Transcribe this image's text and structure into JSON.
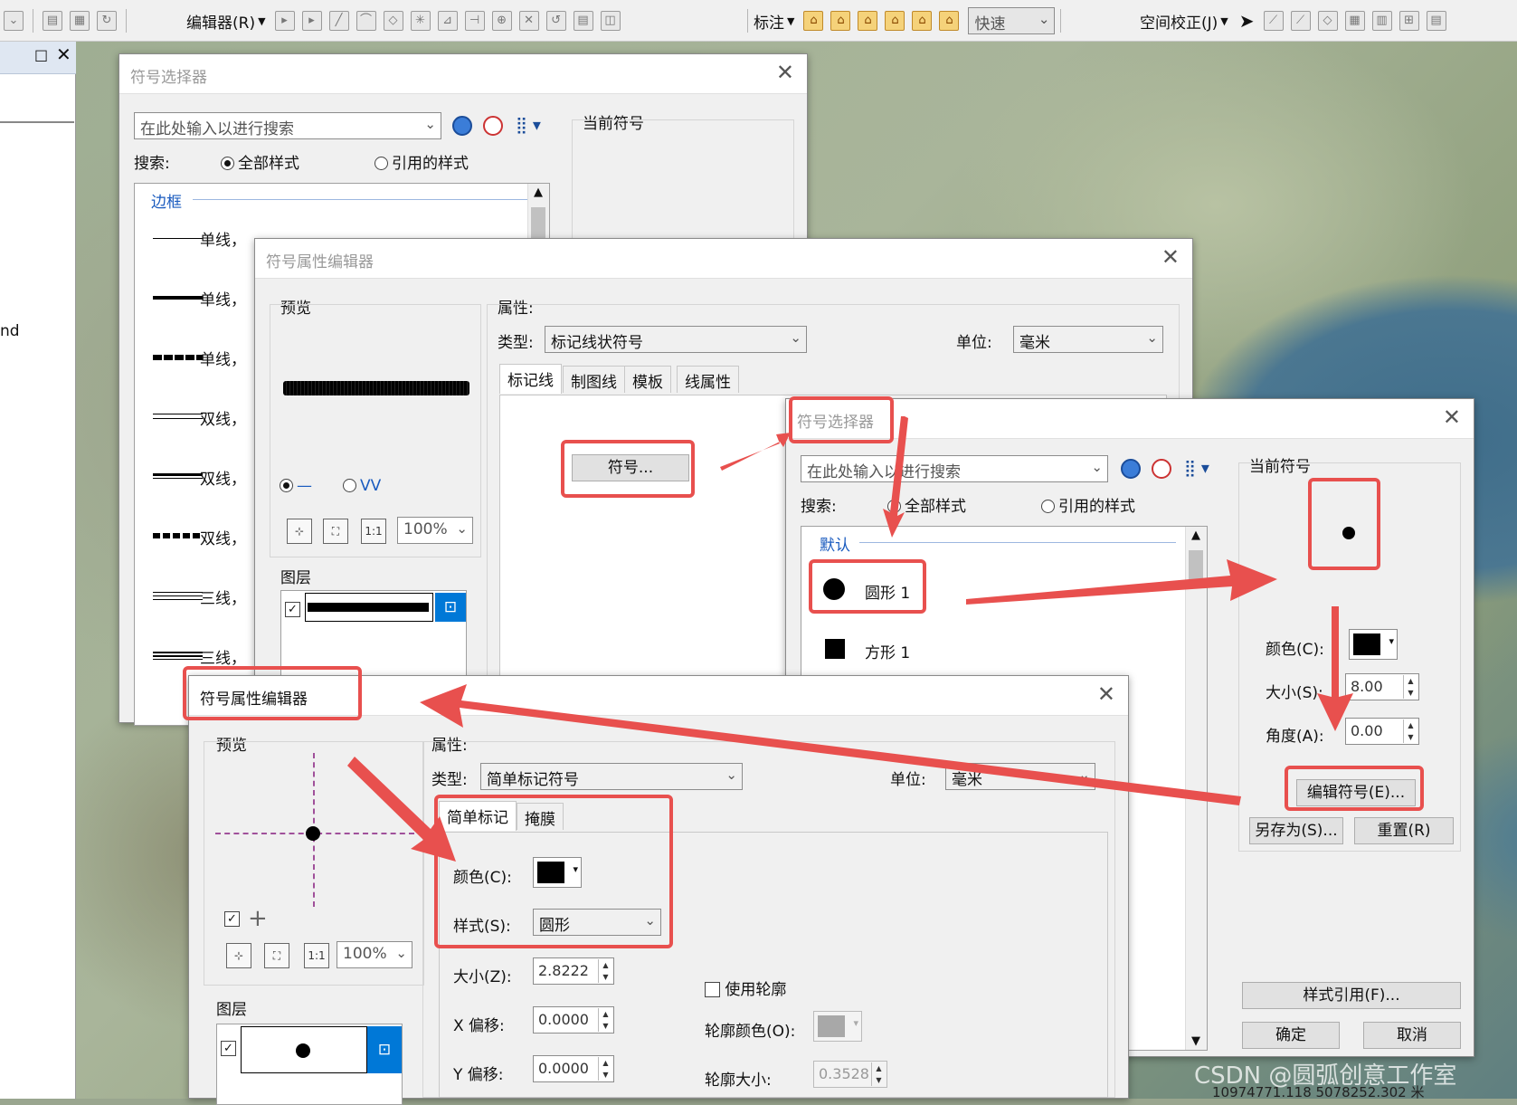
{
  "toolbar": {
    "editor_menu": "编辑器(R)",
    "label_menu": "标注",
    "quick_box": "快速",
    "spatial_menu": "空间校正(J)"
  },
  "left_panel": {
    "partial_text": "nd"
  },
  "map_footer": {
    "coords": "10974771.118  5078252.302 米",
    "watermark": "CSDN @圆弧创意工作室"
  },
  "dlg1": {
    "title": "符号选择器",
    "search_placeholder": "在此处输入以进行搜索",
    "search_label": "搜索:",
    "radio_all": "全部样式",
    "radio_ref": "引用的样式",
    "category": "边框",
    "current_symbol_label": "当前符号",
    "items": [
      "单线，",
      "单线，",
      "单线，",
      "双线，",
      "双线，",
      "双线，",
      "三线，",
      "三线，"
    ]
  },
  "dlg2": {
    "title": "符号属性编辑器",
    "preview_label": "预览",
    "props_label": "属性:",
    "type_label": "类型:",
    "type_value": "标记线状符号",
    "unit_label": "单位:",
    "unit_value": "毫米",
    "tabs": [
      "标记线",
      "制图线",
      "模板",
      "线属性"
    ],
    "symbol_btn": "符号...",
    "zoom": "100%",
    "layers_label": "图层"
  },
  "dlg3": {
    "title": "符号选择器",
    "search_placeholder": "在此处输入以进行搜索",
    "search_label": "搜索:",
    "radio_all": "全部样式",
    "radio_ref": "引用的样式",
    "category": "默认",
    "items": [
      "圆形 1",
      "方形 1"
    ],
    "current_symbol_label": "当前符号",
    "color_label": "颜色(C):",
    "size_label": "大小(S):",
    "size_value": "8.00",
    "angle_label": "角度(A):",
    "angle_value": "0.00",
    "edit_btn": "编辑符号(E)...",
    "saveas_btn": "另存为(S)...",
    "reset_btn": "重置(R)",
    "style_ref_btn": "样式引用(F)...",
    "ok_btn": "确定",
    "cancel_btn": "取消"
  },
  "dlg4": {
    "title": "符号属性编辑器",
    "preview_label": "预览",
    "props_label": "属性:",
    "type_label": "类型:",
    "type_value": "简单标记符号",
    "unit_label": "单位:",
    "unit_value": "毫米",
    "tabs": [
      "简单标记",
      "掩膜"
    ],
    "color_label": "颜色(C):",
    "style_label": "样式(S):",
    "style_value": "圆形",
    "size_label": "大小(Z):",
    "size_value": "2.8222",
    "xoff_label": "X 偏移:",
    "xoff_value": "0.0000",
    "yoff_label": "Y 偏移:",
    "yoff_value": "0.0000",
    "use_outline": "使用轮廓",
    "outline_color_label": "轮廓颜色(O):",
    "outline_size_label": "轮廓大小:",
    "outline_size_value": "0.3528",
    "zoom": "100%",
    "layers_label": "图层"
  },
  "colors": {
    "annotation": "#e8504e",
    "accent": "#0078d7"
  }
}
